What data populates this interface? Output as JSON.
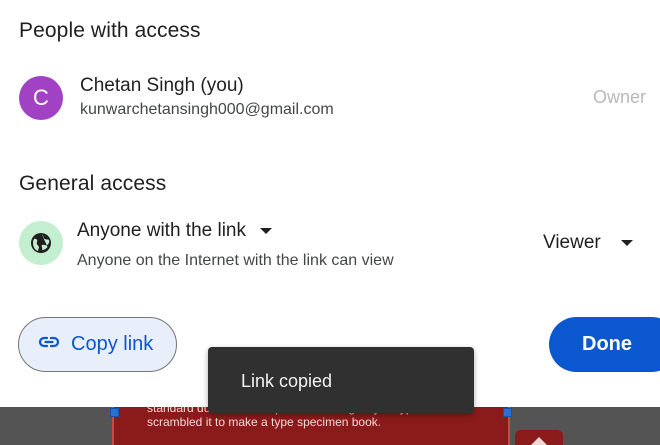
{
  "people_section": {
    "title": "People with access",
    "user": {
      "avatar_initial": "C",
      "avatar_color": "#a142c5",
      "name": "Chetan Singh (you)",
      "email": "kunwarchetansingh000@gmail.com",
      "role": "Owner"
    }
  },
  "general_section": {
    "title": "General access",
    "icon": "globe-icon",
    "access_level": "Anyone with the link",
    "access_description": "Anyone on the Internet with the link can view",
    "role": "Viewer"
  },
  "actions": {
    "copy_link_label": "Copy link",
    "copy_link_icon": "link-icon",
    "done_label": "Done"
  },
  "toast": {
    "message": "Link copied"
  },
  "background_doc": {
    "text": "standard du... unknown printer took a galley of type and scrambled it to make a type specimen book."
  },
  "colors": {
    "accent": "#0b57d0",
    "copy_button_bg": "#e8effa",
    "globe_bg": "#c4eed0",
    "toast_bg": "#303030"
  }
}
